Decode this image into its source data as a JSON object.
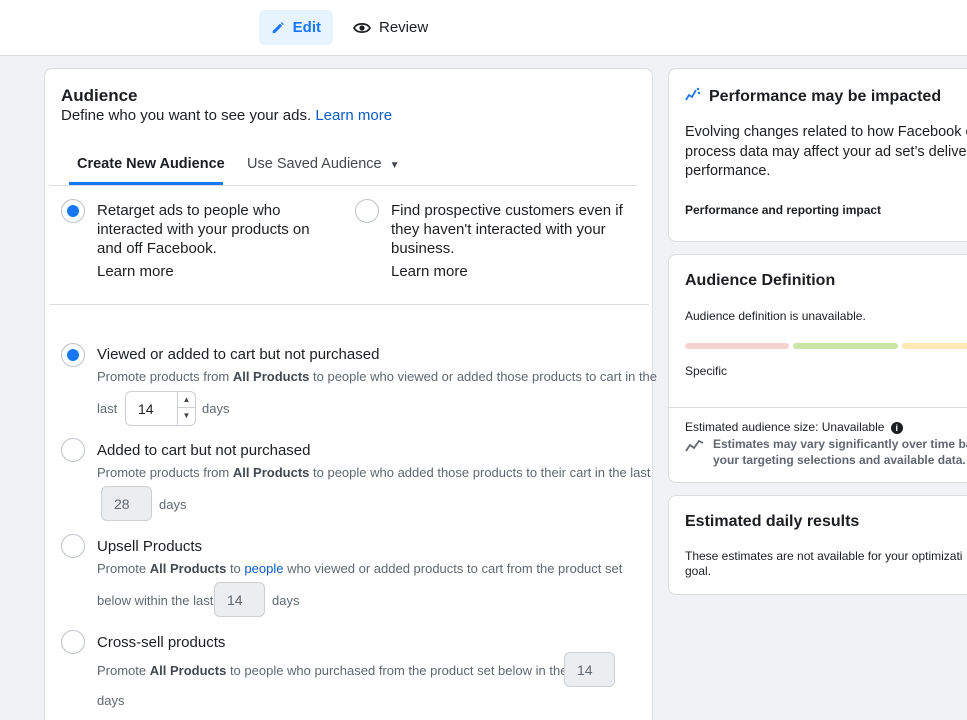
{
  "topbar": {
    "edit_label": "Edit",
    "review_label": "Review"
  },
  "audience": {
    "title": "Audience",
    "description": "Define who you want to see your ads.",
    "learn_more": "Learn more",
    "tabs": [
      {
        "label": "Create New Audience",
        "active": true
      },
      {
        "label": "Use Saved Audience",
        "active": false
      }
    ],
    "choices": [
      {
        "label_lines": [
          "Retarget ads to people who",
          "interacted with your products on",
          "and off Facebook."
        ],
        "learn_more": "Learn more",
        "selected": true
      },
      {
        "label_lines": [
          "Find prospective customers even if",
          "they haven't interacted with your",
          "business."
        ],
        "learn_more": "Learn more",
        "selected": false
      }
    ],
    "options": [
      {
        "label": "Viewed or added to cart but not purchased",
        "selected": true,
        "line1_pre": "Promote products from ",
        "line1_bold": "All Products",
        "line1_post": " to people who viewed or added those products to cart in the",
        "prefix": "last",
        "days_value": "14",
        "suffix": "days"
      },
      {
        "label": "Added to cart but not purchased",
        "selected": false,
        "line1_pre": "Promote products from ",
        "line1_bold": "All Products",
        "line1_post": " to people who added those products to their cart in the last",
        "days_value": "28",
        "suffix": "days"
      },
      {
        "label": "Upsell Products",
        "selected": false,
        "line1_pre": "Promote ",
        "line1_bold": "All Products",
        "line1_mid": " to ",
        "line1_link": "people",
        "line1_post": " who viewed or added products to cart from the product set",
        "prefix": "below within the last",
        "days_value": "14",
        "suffix": "days"
      },
      {
        "label": "Cross-sell products",
        "selected": false,
        "line1_pre": "Promote ",
        "line1_bold": "All Products",
        "line1_post": " to people who purchased from the product set below in the last",
        "days_value": "14",
        "suffix": "days"
      }
    ]
  },
  "performance": {
    "title": "Performance may be impacted",
    "body_lines": [
      "Evolving changes related to how Facebook ca",
      "process data may affect your ad set’s delivery",
      "performance."
    ],
    "footer": "Performance and reporting impact"
  },
  "audience_definition": {
    "title": "Audience Definition",
    "status": "Audience definition is unavailable.",
    "meter_colors": [
      "#f7d3cf",
      "#c9e6a8",
      "#fde9b5"
    ],
    "meter_label": "Specific",
    "size_label": "Estimated audience size: Unavailable",
    "note_lines": [
      "Estimates may vary significantly over time bas",
      "your targeting selections and available data."
    ]
  },
  "daily_results": {
    "title": "Estimated daily results",
    "body_lines": [
      "These estimates are not available for your optimizati",
      "goal."
    ]
  },
  "colors": {
    "accent": "#1877f2",
    "link": "#0a5bc4",
    "tab_active_bg": "#e7f3ff"
  }
}
